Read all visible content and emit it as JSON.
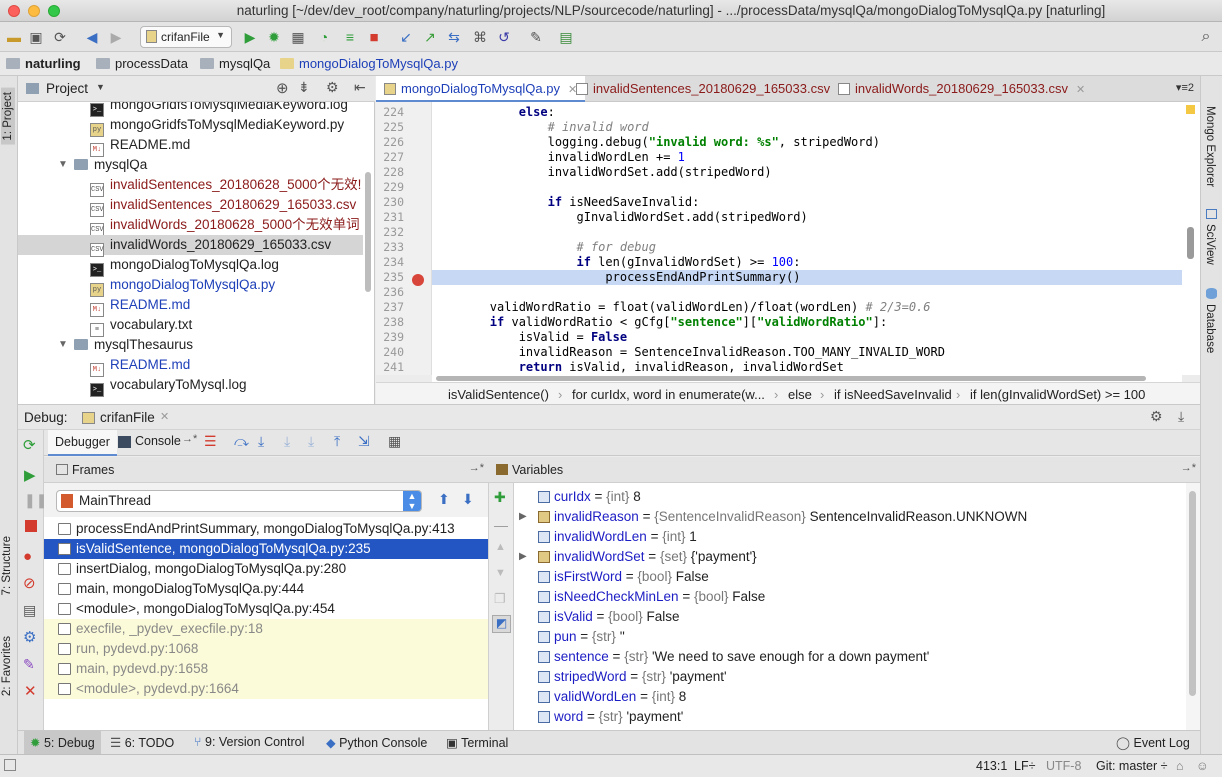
{
  "window": {
    "title": "naturling [~/dev/dev_root/company/naturling/projects/NLP/sourcecode/naturling] - .../processData/mysqlQa/mongoDialogToMysqlQa.py [naturling]"
  },
  "toolbar": {
    "run_config": "crifanFile"
  },
  "nav": {
    "crumbs": [
      "naturling",
      "processData",
      "mysqlQa",
      "mongoDialogToMysqlQa.py"
    ]
  },
  "left_strip": {
    "project": "1: Project",
    "structure": "7: Structure",
    "favorites": "2: Favorites"
  },
  "right_strip": {
    "mongo": "Mongo Explorer",
    "sciview": "SciView",
    "database": "Database"
  },
  "project": {
    "title": "Project",
    "tree": [
      {
        "label": "mongoGridfsToMysqlMediaKeyword.log",
        "type": "log",
        "indent": 2,
        "color": "#222"
      },
      {
        "label": "mongoGridfsToMysqlMediaKeyword.py",
        "type": "py",
        "indent": 2,
        "color": "#222"
      },
      {
        "label": "README.md",
        "type": "md",
        "indent": 2,
        "color": "#222"
      },
      {
        "label": "mysqlQa",
        "type": "folder",
        "indent": 1,
        "color": "#222",
        "expanded": true
      },
      {
        "label": "invalidSentences_20180628_5000个无效!",
        "type": "csv",
        "indent": 2,
        "color": "#8b1a1a"
      },
      {
        "label": "invalidSentences_20180629_165033.csv",
        "type": "csv",
        "indent": 2,
        "color": "#8b1a1a"
      },
      {
        "label": "invalidWords_20180628_5000个无效单词",
        "type": "csv",
        "indent": 2,
        "color": "#8b1a1a"
      },
      {
        "label": "invalidWords_20180629_165033.csv",
        "type": "csv",
        "indent": 2,
        "color": "#222",
        "selected": true
      },
      {
        "label": "mongoDialogToMysqlQa.log",
        "type": "log",
        "indent": 2,
        "color": "#222"
      },
      {
        "label": "mongoDialogToMysqlQa.py",
        "type": "py",
        "indent": 2,
        "color": "#1d3fb8"
      },
      {
        "label": "README.md",
        "type": "md",
        "indent": 2,
        "color": "#1d3fb8"
      },
      {
        "label": "vocabulary.txt",
        "type": "txt",
        "indent": 2,
        "color": "#222"
      },
      {
        "label": "mysqlThesaurus",
        "type": "folder",
        "indent": 1,
        "color": "#222",
        "expanded": true
      },
      {
        "label": "README.md",
        "type": "md",
        "indent": 2,
        "color": "#1d3fb8"
      },
      {
        "label": "vocabularyToMysql.log",
        "type": "log",
        "indent": 2,
        "color": "#222"
      }
    ]
  },
  "editor": {
    "tabs": [
      {
        "label": "mongoDialogToMysqlQa.py",
        "active": true,
        "color": "#1d3fb8"
      },
      {
        "label": "invalidSentences_20180629_165033.csv",
        "active": false,
        "color": "#8b1a1a"
      },
      {
        "label": "invalidWords_20180629_165033.csv",
        "active": false,
        "color": "#8b1a1a"
      }
    ],
    "tab_count": "2",
    "lines": [
      {
        "n": "224",
        "html": "            <span class=\"kw\">else</span>:"
      },
      {
        "n": "225",
        "html": "                <span class=\"cm\"># invalid word</span>"
      },
      {
        "n": "226",
        "html": "                logging.debug(<span class=\"st\">\"invalid word: %s\"</span>, stripedWord)"
      },
      {
        "n": "227",
        "html": "                invalidWordLen += <span class=\"nm\">1</span>"
      },
      {
        "n": "228",
        "html": "                invalidWordSet.add(stripedWord)"
      },
      {
        "n": "229",
        "html": ""
      },
      {
        "n": "230",
        "html": "                <span class=\"kw\">if</span> isNeedSaveInvalid:"
      },
      {
        "n": "231",
        "html": "                    gInvalidWordSet.add(stripedWord)"
      },
      {
        "n": "232",
        "html": ""
      },
      {
        "n": "233",
        "html": "                    <span class=\"cm\"># for debug</span>"
      },
      {
        "n": "234",
        "html": "                    <span class=\"kw\">if</span> len(gInvalidWordSet) >= <span class=\"nm\">100</span>:"
      },
      {
        "n": "235",
        "html": "                        processEndAndPrintSummary()",
        "hl": true
      },
      {
        "n": "236",
        "html": ""
      },
      {
        "n": "237",
        "html": "        validWordRatio = float(validWordLen)/float(wordLen) <span class=\"cm\"># 2/3=0.6</span>"
      },
      {
        "n": "238",
        "html": "        <span class=\"kw\">if</span> validWordRatio &lt; gCfg[<span class=\"st\">\"sentence\"</span>][<span class=\"st\">\"validWordRatio\"</span>]:"
      },
      {
        "n": "239",
        "html": "            isValid = <span class=\"kw\">False</span>"
      },
      {
        "n": "240",
        "html": "            invalidReason = SentenceInvalidReason.TOO_MANY_INVALID_WORD"
      },
      {
        "n": "241",
        "html": "            <span class=\"kw\">return</span> isValid, invalidReason, invalidWordSet"
      }
    ],
    "breadcrumb": [
      "isValidSentence()",
      "for curIdx, word in enumerate(w...",
      "else",
      "if isNeedSaveInvalid",
      "if len(gInvalidWordSet) >= 100"
    ]
  },
  "debug": {
    "label": "Debug:",
    "config": "crifanFile",
    "tabs": {
      "debugger": "Debugger",
      "console": "Console"
    },
    "frames_title": "Frames",
    "thread": "MainThread",
    "frames": [
      {
        "label": "processEndAndPrintSummary, mongoDialogToMysqlQa.py:413",
        "kind": "user"
      },
      {
        "label": "isValidSentence, mongoDialogToMysqlQa.py:235",
        "kind": "sel"
      },
      {
        "label": "insertDialog, mongoDialogToMysqlQa.py:280",
        "kind": "user"
      },
      {
        "label": "main, mongoDialogToMysqlQa.py:444",
        "kind": "user"
      },
      {
        "label": "<module>, mongoDialogToMysqlQa.py:454",
        "kind": "user"
      },
      {
        "label": "execfile, _pydev_execfile.py:18",
        "kind": "lib"
      },
      {
        "label": "run, pydevd.py:1068",
        "kind": "lib"
      },
      {
        "label": "main, pydevd.py:1658",
        "kind": "lib"
      },
      {
        "label": "<module>, pydevd.py:1664",
        "kind": "lib"
      }
    ],
    "variables_title": "Variables",
    "variables": [
      {
        "name": "curIdx",
        "type": "{int}",
        "value": "8",
        "obj": false,
        "expand": false
      },
      {
        "name": "invalidReason",
        "type": "{SentenceInvalidReason}",
        "value": "SentenceInvalidReason.UNKNOWN",
        "obj": true,
        "expand": true
      },
      {
        "name": "invalidWordLen",
        "type": "{int}",
        "value": "1",
        "obj": false,
        "expand": false
      },
      {
        "name": "invalidWordSet",
        "type": "{set}",
        "value": "{'payment'}",
        "obj": true,
        "expand": true
      },
      {
        "name": "isFirstWord",
        "type": "{bool}",
        "value": "False",
        "obj": false,
        "expand": false
      },
      {
        "name": "isNeedCheckMinLen",
        "type": "{bool}",
        "value": "False",
        "obj": false,
        "expand": false
      },
      {
        "name": "isValid",
        "type": "{bool}",
        "value": "False",
        "obj": false,
        "expand": false
      },
      {
        "name": "pun",
        "type": "{str}",
        "value": "''",
        "obj": false,
        "expand": false
      },
      {
        "name": "sentence",
        "type": "{str}",
        "value": "'We need to save enough for a down payment'",
        "obj": false,
        "expand": false
      },
      {
        "name": "stripedWord",
        "type": "{str}",
        "value": "'payment'",
        "obj": false,
        "expand": false
      },
      {
        "name": "validWordLen",
        "type": "{int}",
        "value": "8",
        "obj": false,
        "expand": false
      },
      {
        "name": "word",
        "type": "{str}",
        "value": "'payment'",
        "obj": false,
        "expand": false
      }
    ]
  },
  "bottom_tabs": [
    {
      "label": "5: Debug",
      "active": true
    },
    {
      "label": "6: TODO",
      "active": false
    },
    {
      "label": "9: Version Control",
      "active": false
    },
    {
      "label": "Python Console",
      "active": false
    },
    {
      "label": "Terminal",
      "active": false
    }
  ],
  "event_log": "Event Log",
  "status": {
    "position": "413:1",
    "line_sep": "LF÷",
    "encoding": "UTF-8",
    "vcs": "Git: master ÷"
  },
  "colors": {
    "selection": "#2356c2",
    "exec_line": "#c7d8f4",
    "accent": "#5d8ad1"
  }
}
